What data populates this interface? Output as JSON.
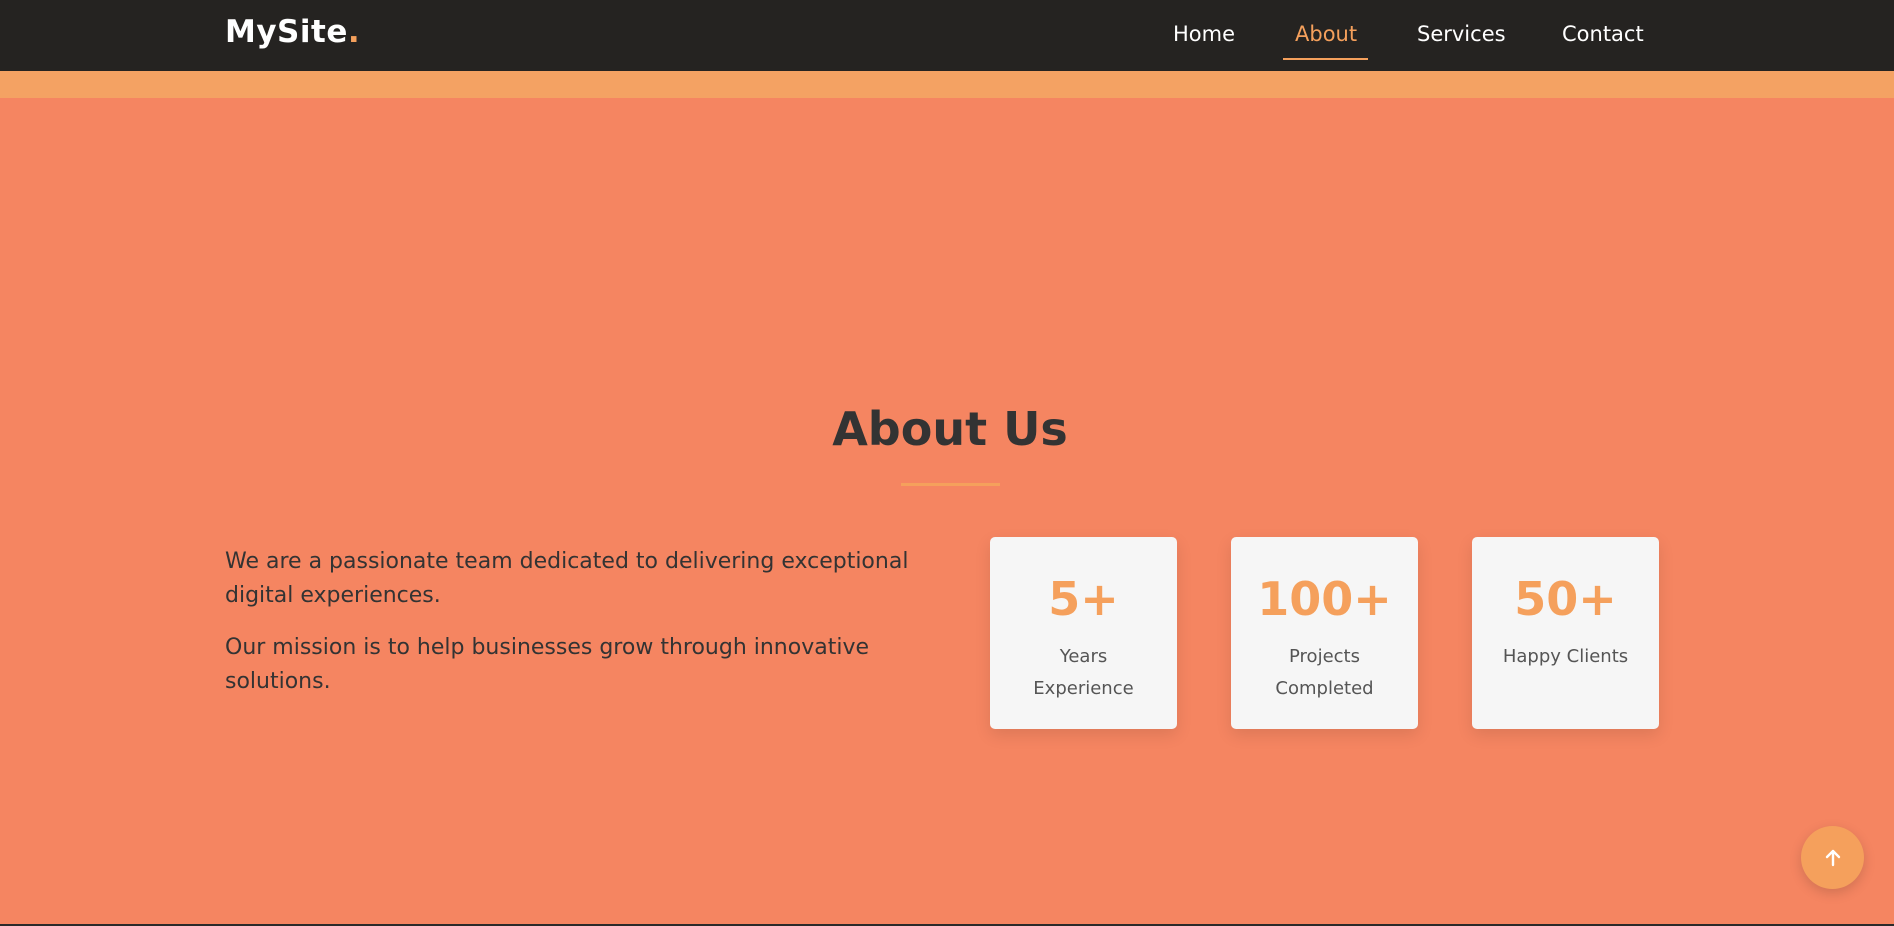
{
  "navbar": {
    "logo_text": "MySite",
    "logo_dot": ".",
    "links": [
      {
        "label": "Home",
        "active": false
      },
      {
        "label": "About",
        "active": true
      },
      {
        "label": "Services",
        "active": false
      },
      {
        "label": "Contact",
        "active": false
      }
    ]
  },
  "about": {
    "title": "About Us",
    "paragraphs": [
      "We are a passionate team dedicated to delivering exceptional digital experiences.",
      "Our mission is to help businesses grow through innovative solutions."
    ],
    "stats": [
      {
        "value": "5+",
        "label": "Years Experience"
      },
      {
        "value": "100+",
        "label": "Projects Completed"
      },
      {
        "value": "50+",
        "label": "Happy Clients"
      }
    ]
  },
  "scroll_top": {
    "icon": "arrow-up-icon"
  },
  "colors": {
    "accent": "#f5a05c",
    "background": "#f58561",
    "navbar": "#252321",
    "text_dark": "#333333",
    "card_bg": "#f6f6f6"
  }
}
